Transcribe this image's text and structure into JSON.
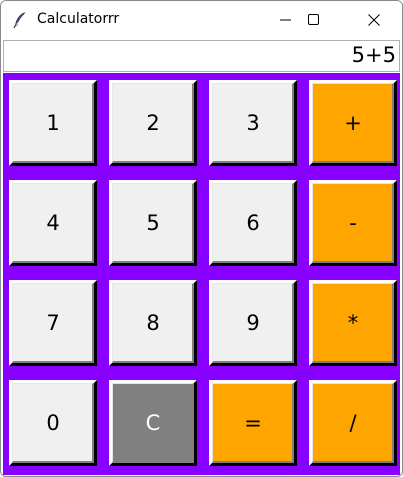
{
  "window": {
    "title": "Calculatorrr",
    "icon": "feather-icon",
    "controls": [
      "minimize-icon",
      "maximize-icon",
      "close-icon"
    ]
  },
  "display": {
    "value": "5+5"
  },
  "colors": {
    "pad_background": "#8800ff",
    "number_button": "#f0f0f0",
    "operator_button": "#ffa500",
    "clear_button": "#808080"
  },
  "keys": {
    "k1": "1",
    "k2": "2",
    "k3": "3",
    "plus": "+",
    "k4": "4",
    "k5": "5",
    "k6": "6",
    "minus": "-",
    "k7": "7",
    "k8": "8",
    "k9": "9",
    "multiply": "*",
    "k0": "0",
    "clear": "C",
    "equals": "=",
    "divide": "/"
  }
}
